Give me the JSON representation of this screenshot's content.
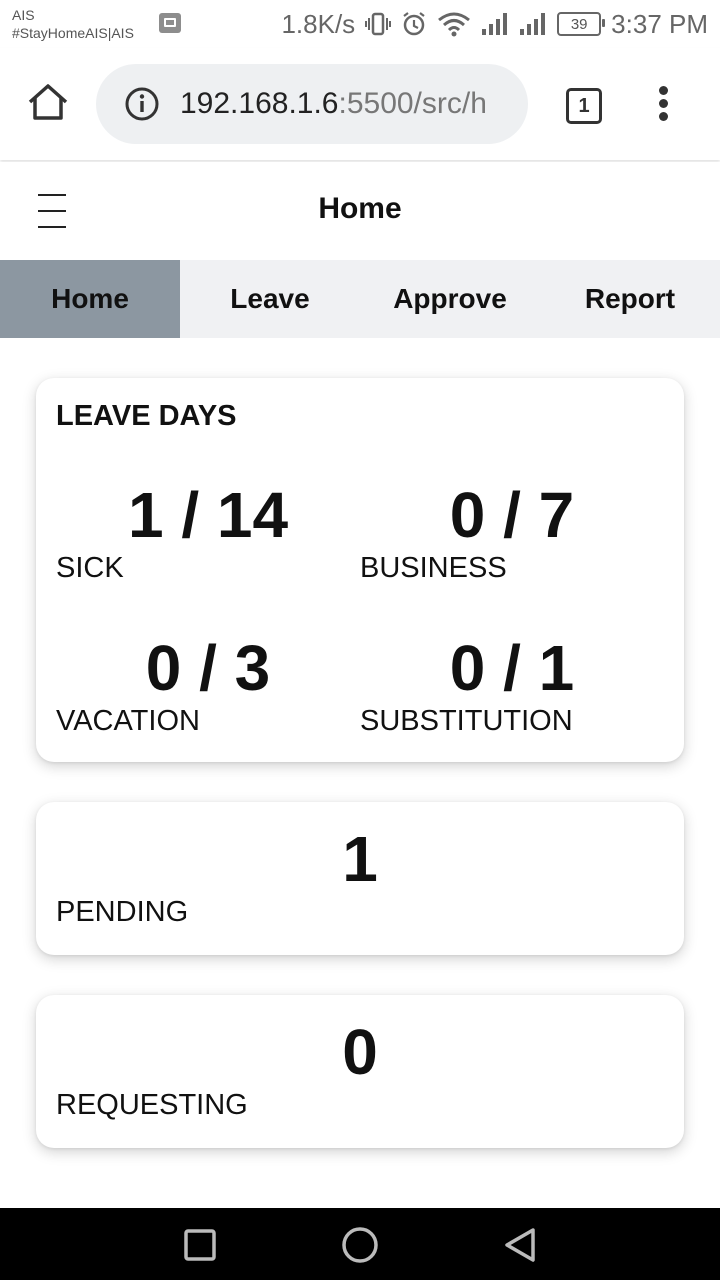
{
  "status_bar": {
    "carrier_line1": "AIS",
    "carrier_line2": "#StayHomeAIS|AIS",
    "net_speed": "1.8K/s",
    "battery": "39",
    "time": "3:37 PM",
    "icons": [
      "gallery-icon",
      "vibrate-icon",
      "alarm-icon",
      "wifi-icon",
      "signal-icon",
      "signal-icon",
      "battery-icon"
    ]
  },
  "browser": {
    "url_host": "192.168.1.6",
    "url_path": ":5500/src/h",
    "tab_count": "1"
  },
  "app": {
    "title": "Home",
    "tabs": [
      {
        "label": "Home",
        "active": true
      },
      {
        "label": "Leave",
        "active": false
      },
      {
        "label": "Approve",
        "active": false
      },
      {
        "label": "Report",
        "active": false
      }
    ]
  },
  "leave_days": {
    "title": "LEAVE DAYS",
    "sick": {
      "value": "1 / 14",
      "label": "SICK"
    },
    "business": {
      "value": "0 / 7",
      "label": "BUSINESS"
    },
    "vacation": {
      "value": "0 / 3",
      "label": "VACATION"
    },
    "substitution": {
      "value": "0 / 1",
      "label": "SUBSTITUTION"
    }
  },
  "pending": {
    "value": "1",
    "label": "PENDING"
  },
  "requesting": {
    "value": "0",
    "label": "REQUESTING"
  },
  "colors": {
    "active_tab": "#8c97a1",
    "tab_bar": "#f0f1f3",
    "url_pill": "#eef0f2",
    "nav_bar": "#000000"
  }
}
